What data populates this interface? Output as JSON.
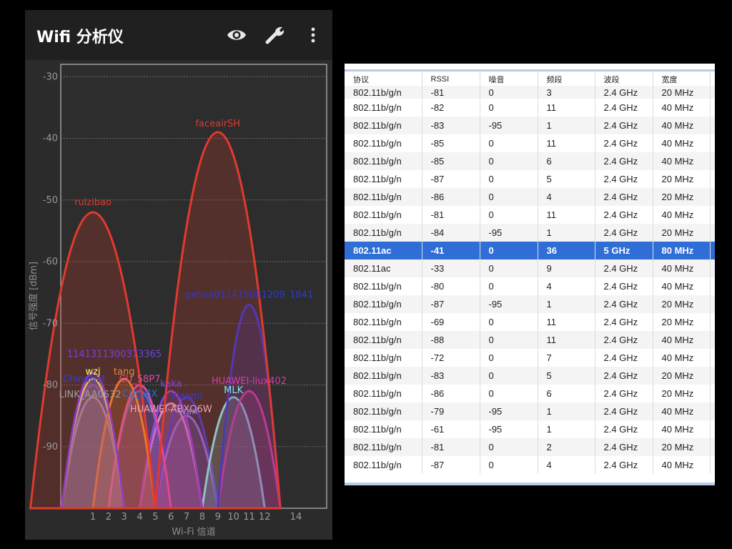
{
  "app": {
    "title": "Wifi 分析仪"
  },
  "icons": {
    "eye": "eye-icon",
    "wrench": "wrench-icon",
    "more": "more-vert-icon"
  },
  "chart_data": {
    "type": "area",
    "ylabel": "信号强度 [dBm]",
    "xlabel": "Wi-Fi 信道",
    "ylim": [
      -100,
      -28
    ],
    "yticks": [
      -30,
      -40,
      -50,
      -60,
      -70,
      -80,
      -90
    ],
    "xticks": [
      1,
      2,
      3,
      4,
      5,
      6,
      7,
      8,
      9,
      10,
      11,
      12,
      14
    ],
    "grid": true,
    "series": [
      {
        "name": "ruizibao",
        "channel": 1,
        "width": 40,
        "signal": -52,
        "color": "#e03a2e"
      },
      {
        "name": "faceairSH",
        "channel": 9,
        "width": 40,
        "signal": -39,
        "color": "#e03a2e"
      },
      {
        "name": "gehua011415081209 1841",
        "channel": 11,
        "width": 20,
        "signal": -67,
        "color": "#2b38d8"
      },
      {
        "name": "1141311300373365",
        "channel": 1,
        "width": 20,
        "signal": -78,
        "color": "#7a3ee0"
      },
      {
        "name": "wzj",
        "channel": 1,
        "width": 20,
        "signal": -79,
        "color": "#ffff55"
      },
      {
        "name": "ChinaNet",
        "channel": 1,
        "width": 20,
        "signal": -80,
        "color": "#3b3bd8"
      },
      {
        "name": "LINK_AA0632",
        "channel": 1,
        "width": 20,
        "signal": -82,
        "color": "#9e9e9e"
      },
      {
        "name": "tang",
        "channel": 3,
        "width": 20,
        "signal": -79,
        "color": "#f08a28"
      },
      {
        "name": "CU_58P7",
        "channel": 4,
        "width": 20,
        "signal": -80,
        "color": "#e24aa7"
      },
      {
        "name": "CU_L8X",
        "channel": 4,
        "width": 20,
        "signal": -81,
        "color": "#2a6fdc"
      },
      {
        "name": "HUAWEI-ABXQ6W",
        "channel": 6,
        "width": 20,
        "signal": -83,
        "color": "#f0a0b0"
      },
      {
        "name": "kaka",
        "channel": 6,
        "width": 20,
        "signal": -81,
        "color": "#8a3ee0"
      },
      {
        "name": "xiaomi",
        "channel": 7,
        "width": 20,
        "signal": -82,
        "color": "#3a3ad0"
      },
      {
        "name": "wan",
        "channel": 7,
        "width": 20,
        "signal": -85,
        "color": "#9c7ae0"
      },
      {
        "name": "HUAWEI-liux402",
        "channel": 11,
        "width": 20,
        "signal": -81,
        "color": "#d23ea8"
      },
      {
        "name": "MLK",
        "channel": 10,
        "width": 20,
        "signal": -82,
        "color": "#7ee8f0"
      }
    ]
  },
  "table": {
    "columns": [
      "协议",
      "RSSI",
      "噪音",
      "频段",
      "波段",
      "宽度"
    ],
    "rows": [
      [
        "802.11b/g/n",
        "-81",
        "0",
        "3",
        "2.4 GHz",
        "20 MHz"
      ],
      [
        "802.11b/g/n",
        "-82",
        "0",
        "11",
        "2.4 GHz",
        "40 MHz"
      ],
      [
        "802.11b/g/n",
        "-83",
        "-95",
        "1",
        "2.4 GHz",
        "40 MHz"
      ],
      [
        "802.11b/g/n",
        "-85",
        "0",
        "11",
        "2.4 GHz",
        "40 MHz"
      ],
      [
        "802.11b/g/n",
        "-85",
        "0",
        "6",
        "2.4 GHz",
        "40 MHz"
      ],
      [
        "802.11b/g/n",
        "-87",
        "0",
        "5",
        "2.4 GHz",
        "20 MHz"
      ],
      [
        "802.11b/g/n",
        "-86",
        "0",
        "4",
        "2.4 GHz",
        "20 MHz"
      ],
      [
        "802.11b/g/n",
        "-81",
        "0",
        "11",
        "2.4 GHz",
        "40 MHz"
      ],
      [
        "802.11b/g/n",
        "-84",
        "-95",
        "1",
        "2.4 GHz",
        "20 MHz"
      ],
      [
        "802.11ac",
        "-41",
        "0",
        "36",
        "5 GHz",
        "80 MHz"
      ],
      [
        "802.11ac",
        "-33",
        "0",
        "9",
        "2.4 GHz",
        "40 MHz"
      ],
      [
        "802.11b/g/n",
        "-80",
        "0",
        "4",
        "2.4 GHz",
        "40 MHz"
      ],
      [
        "802.11b/g/n",
        "-87",
        "-95",
        "1",
        "2.4 GHz",
        "20 MHz"
      ],
      [
        "802.11b/g/n",
        "-69",
        "0",
        "11",
        "2.4 GHz",
        "20 MHz"
      ],
      [
        "802.11b/g/n",
        "-88",
        "0",
        "11",
        "2.4 GHz",
        "40 MHz"
      ],
      [
        "802.11b/g/n",
        "-72",
        "0",
        "7",
        "2.4 GHz",
        "40 MHz"
      ],
      [
        "802.11b/g/n",
        "-83",
        "0",
        "5",
        "2.4 GHz",
        "20 MHz"
      ],
      [
        "802.11b/g/n",
        "-86",
        "0",
        "6",
        "2.4 GHz",
        "20 MHz"
      ],
      [
        "802.11b/g/n",
        "-79",
        "-95",
        "1",
        "2.4 GHz",
        "40 MHz"
      ],
      [
        "802.11b/g/n",
        "-61",
        "-95",
        "1",
        "2.4 GHz",
        "40 MHz"
      ],
      [
        "802.11b/g/n",
        "-81",
        "0",
        "2",
        "2.4 GHz",
        "20 MHz"
      ],
      [
        "802.11b/g/n",
        "-87",
        "0",
        "4",
        "2.4 GHz",
        "40 MHz"
      ]
    ],
    "selected_row": 9,
    "selected_color": "#2f6ed6"
  }
}
